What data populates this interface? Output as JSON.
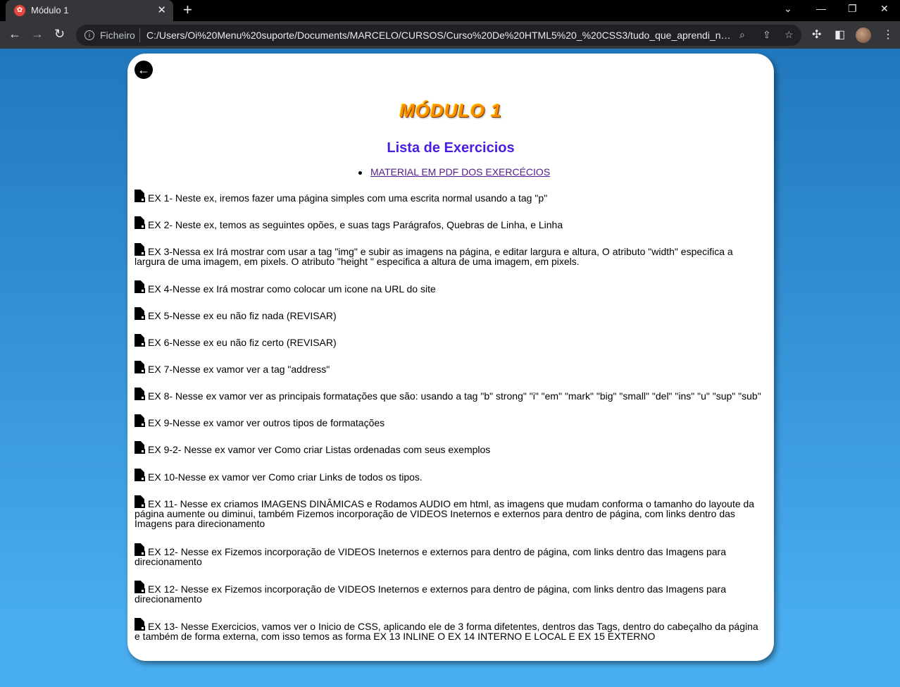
{
  "browser": {
    "tab_title": "Módulo 1",
    "new_tab": "+",
    "scheme": "Ficheiro",
    "url": "C:/Users/Oi%20Menu%20suporte/Documents/MARCELO/CURSOS/Curso%20De%20HTML5%20_%20CSS3/tudo_que_aprendi_no_Curso..."
  },
  "page": {
    "back_icon": "arrow-left-icon",
    "module_title": "MÓDULO 1",
    "list_title": "Lista de Exercicios",
    "pdf_link": "MATERIAL EM PDF DOS EXERCÉCIOS",
    "exercises": [
      "EX 1- Neste ex, iremos fazer uma página simples com uma escrita normal usando a tag \"p\"",
      "EX 2- Neste ex, temos as seguintes opões, e suas tags Parágrafos, Quebras de Linha, e Linha",
      "EX 3-Nessa ex Irá mostrar com usar a tag \"img\" e subir as imagens na página, e editar largura e altura, O atributo \"width\" especifica a largura de uma imagem, em pixels. O atributo \"height \" especifica a altura de uma imagem, em pixels.",
      "EX 4-Nesse ex Irá mostrar como colocar um icone na URL do site",
      "EX 5-Nesse ex eu não fiz nada (REVISAR)",
      "EX 6-Nesse ex eu não fiz certo (REVISAR)",
      "EX 7-Nesse ex vamor ver a tag \"address\"",
      "EX 8- Nesse ex vamor ver as principais formatações que são: usando a tag \"b\" strong\" \"i\" \"em\" \"mark\" \"big\" \"small\" \"del\" \"ins\" \"u\" \"sup\" \"sub\"",
      "EX 9-Nesse ex vamor ver outros tipos de formatações",
      "EX 9-2- Nesse ex vamor ver Como criar Listas ordenadas com seus exemplos",
      "EX 10-Nesse ex vamor ver Como criar Links de todos os tipos.",
      "EX 11- Nesse ex criamos IMAGENS DINÂMICAS e Rodamos AUDIO em html, as imagens que mudam conforma o tamanho do layoute da página aumente ou diminui, também Fizemos incorporação de VIDEOS Ineternos e externos para dentro de página, com links dentro das Imagens para direcionamento",
      "EX 12- Nesse ex Fizemos incorporação de VIDEOS Ineternos e externos para dentro de página, com links dentro das Imagens para direcionamento",
      "EX 12- Nesse ex Fizemos incorporação de VIDEOS Ineternos e externos para dentro de página, com links dentro das Imagens para direcionamento",
      "EX 13- Nesse Exercicios, vamos ver o Inicio de CSS, aplicando ele de 3 forma difetentes, dentros das Tags, dentro do cabeçalho da página e também de forma externa, com isso temos as forma EX 13 INLINE O EX 14 INTERNO E LOCAL E EX 15 EXTERNO"
    ]
  },
  "colors": {
    "page_bg_top": "#1e73b8",
    "page_bg_bottom": "#49aef0",
    "title_orange": "#ff8c00",
    "list_title": "#4b1de0",
    "link": "#551a8b"
  }
}
